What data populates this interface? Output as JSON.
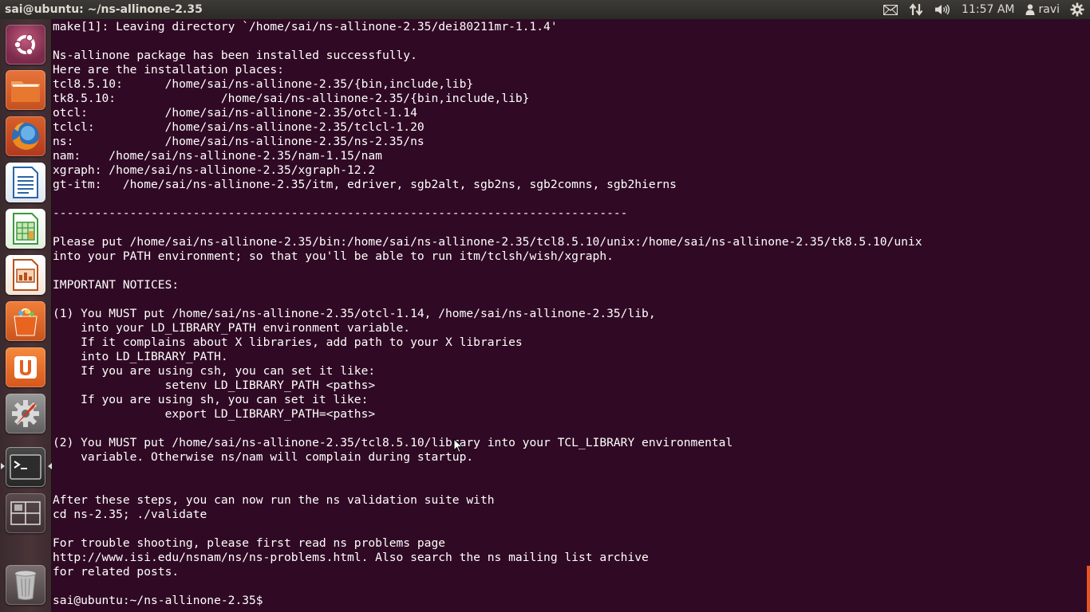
{
  "panel": {
    "window_title": "sai@ubuntu: ~/ns-allinone-2.35",
    "clock": "11:57 AM",
    "user": "ravi",
    "indicators": [
      "mail-icon",
      "network-icon",
      "volume-icon",
      "user-icon",
      "gear-icon"
    ]
  },
  "launcher": {
    "items": [
      {
        "name": "dash-home",
        "icon": "ubuntu-logo-icon"
      },
      {
        "name": "files",
        "icon": "folder-icon"
      },
      {
        "name": "firefox",
        "icon": "firefox-icon"
      },
      {
        "name": "libreoffice-writer",
        "icon": "writer-icon"
      },
      {
        "name": "libreoffice-calc",
        "icon": "calc-icon"
      },
      {
        "name": "libreoffice-impress",
        "icon": "impress-icon"
      },
      {
        "name": "software-center",
        "icon": "shopping-bag-icon"
      },
      {
        "name": "ubuntu-one",
        "icon": "ubuntu-one-icon"
      },
      {
        "name": "system-settings",
        "icon": "settings-icon"
      },
      {
        "name": "terminal",
        "icon": "terminal-icon",
        "active": true
      },
      {
        "name": "workspace-switcher",
        "icon": "workspace-icon"
      },
      {
        "name": "trash",
        "icon": "trash-icon"
      }
    ]
  },
  "terminal": {
    "lines": [
      "make[1]: Leaving directory `/home/sai/ns-allinone-2.35/dei80211mr-1.1.4'",
      "",
      "Ns-allinone package has been installed successfully.",
      "Here are the installation places:",
      "tcl8.5.10:      /home/sai/ns-allinone-2.35/{bin,include,lib}",
      "tk8.5.10:               /home/sai/ns-allinone-2.35/{bin,include,lib}",
      "otcl:           /home/sai/ns-allinone-2.35/otcl-1.14",
      "tclcl:          /home/sai/ns-allinone-2.35/tclcl-1.20",
      "ns:             /home/sai/ns-allinone-2.35/ns-2.35/ns",
      "nam:    /home/sai/ns-allinone-2.35/nam-1.15/nam",
      "xgraph: /home/sai/ns-allinone-2.35/xgraph-12.2",
      "gt-itm:   /home/sai/ns-allinone-2.35/itm, edriver, sgb2alt, sgb2ns, sgb2comns, sgb2hierns",
      "",
      "----------------------------------------------------------------------------------",
      "",
      "Please put /home/sai/ns-allinone-2.35/bin:/home/sai/ns-allinone-2.35/tcl8.5.10/unix:/home/sai/ns-allinone-2.35/tk8.5.10/unix",
      "into your PATH environment; so that you'll be able to run itm/tclsh/wish/xgraph.",
      "",
      "IMPORTANT NOTICES:",
      "",
      "(1) You MUST put /home/sai/ns-allinone-2.35/otcl-1.14, /home/sai/ns-allinone-2.35/lib,",
      "    into your LD_LIBRARY_PATH environment variable.",
      "    If it complains about X libraries, add path to your X libraries",
      "    into LD_LIBRARY_PATH.",
      "    If you are using csh, you can set it like:",
      "                setenv LD_LIBRARY_PATH <paths>",
      "    If you are using sh, you can set it like:",
      "                export LD_LIBRARY_PATH=<paths>",
      "",
      "(2) You MUST put /home/sai/ns-allinone-2.35/tcl8.5.10/library into your TCL_LIBRARY environmental",
      "    variable. Otherwise ns/nam will complain during startup.",
      "",
      "",
      "After these steps, you can now run the ns validation suite with",
      "cd ns-2.35; ./validate",
      "",
      "For trouble shooting, please first read ns problems page",
      "http://www.isi.edu/nsnam/ns/ns-problems.html. Also search the ns mailing list archive",
      "for related posts.",
      "",
      "sai@ubuntu:~/ns-allinone-2.35$ "
    ]
  }
}
